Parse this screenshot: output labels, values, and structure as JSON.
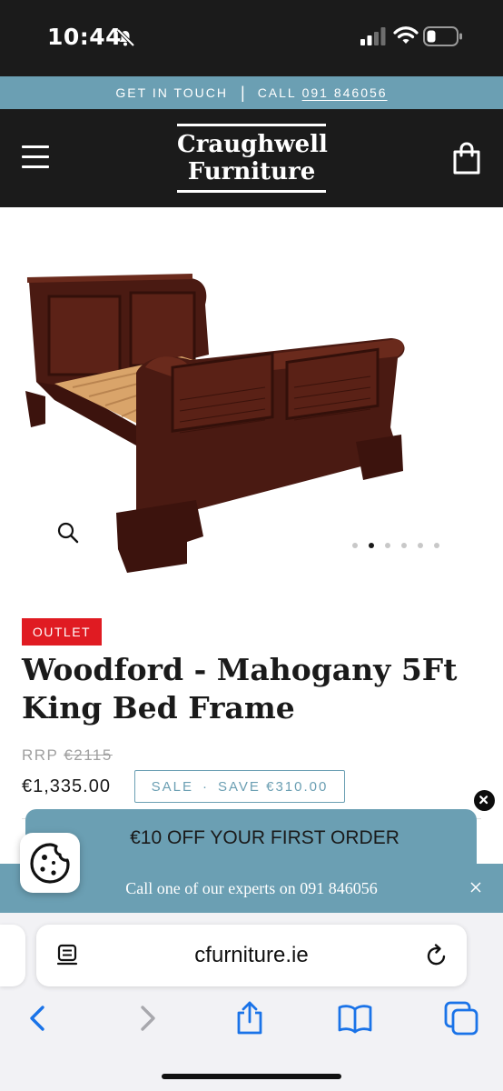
{
  "status_bar": {
    "time": "10:44",
    "icons": [
      "bell-slash-icon",
      "cellular-signal-icon",
      "wifi-icon",
      "battery-icon"
    ]
  },
  "contact_bar": {
    "get_in_touch": "GET IN TOUCH",
    "separator": "|",
    "call_label": "CALL",
    "phone": "091 846056"
  },
  "header": {
    "logo_line1": "Craughwell",
    "logo_line2": "Furniture",
    "menu_icon": "hamburger-menu-icon",
    "cart_icon": "shopping-bag-icon"
  },
  "product": {
    "image_alt": "mahogany sleigh bed frame",
    "carousel": {
      "slide_count": 6,
      "active_index": 1
    },
    "badge": "OUTLET",
    "title": "Woodford - Mahogany 5Ft King Bed Frame",
    "rrp_label": "RRP",
    "rrp_value": "€2115",
    "price": "€1,335.00",
    "sale_label": "SALE",
    "sale_separator": "·",
    "save_text": "SAVE €310.00"
  },
  "popup": {
    "text": "€10 OFF YOUR FIRST ORDER"
  },
  "expert_bar": {
    "text": "Call one of our experts on 091 846056",
    "close_symbol": "×"
  },
  "browser": {
    "url": "cfurniture.ie",
    "toolbar": [
      "back-icon",
      "forward-icon",
      "share-icon",
      "bookmarks-icon",
      "tabs-icon"
    ]
  },
  "colors": {
    "header_bg": "#1b1b1b",
    "accent_blue": "#6b9fb3",
    "badge_red": "#e01b22",
    "muted_gray": "#a0a0a0",
    "ios_blue": "#1a73e8"
  }
}
